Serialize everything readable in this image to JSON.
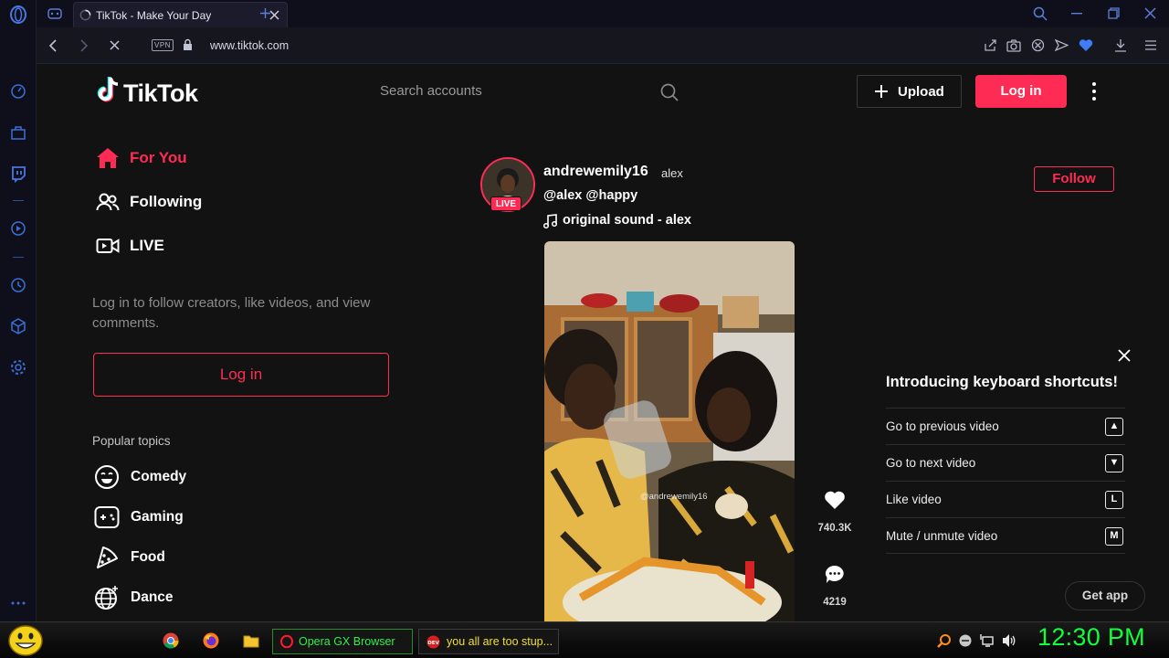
{
  "browser": {
    "tab_title": "TikTok - Make Your Day",
    "url": "www.tiktok.com",
    "vpn_label": "VPN"
  },
  "header": {
    "logo": "TikTok",
    "search_placeholder": "Search accounts",
    "upload_label": "Upload",
    "login_label": "Log in"
  },
  "sidebar": {
    "nav": [
      {
        "label": "For You",
        "icon": "home-icon",
        "active": true
      },
      {
        "label": "Following",
        "icon": "users-icon",
        "active": false
      },
      {
        "label": "LIVE",
        "icon": "live-video-icon",
        "active": false
      }
    ],
    "login_prompt": "Log in to follow creators, like videos, and view comments.",
    "login_button": "Log in",
    "popular_title": "Popular topics",
    "topics": [
      {
        "label": "Comedy",
        "icon": "smile-icon"
      },
      {
        "label": "Gaming",
        "icon": "gamepad-icon"
      },
      {
        "label": "Food",
        "icon": "pizza-icon"
      },
      {
        "label": "Dance",
        "icon": "disco-ball-icon"
      }
    ]
  },
  "post": {
    "author_name": "andrewemily16",
    "author_nick": "alex",
    "live_badge": "LIVE",
    "mentions": "@alex @happy",
    "sound": "original sound - alex",
    "follow_label": "Follow",
    "watermark": "@andrewemily16",
    "likes": "740.3K",
    "comments": "4219"
  },
  "shortcuts": {
    "title": "Introducing keyboard shortcuts!",
    "items": [
      {
        "label": "Go to previous video",
        "key": "▲"
      },
      {
        "label": "Go to next video",
        "key": "▼"
      },
      {
        "label": "Like video",
        "key": "L"
      },
      {
        "label": "Mute / unmute video",
        "key": "M"
      }
    ],
    "get_app": "Get app"
  },
  "taskbar": {
    "opera_label": "Opera GX Browser",
    "dev_label": "you all are too stup...",
    "clock": "12:30 PM"
  },
  "colors": {
    "accent": "#fe2c55",
    "clock": "#10ff3c",
    "opera_sidebar": "#3a6fd6"
  }
}
